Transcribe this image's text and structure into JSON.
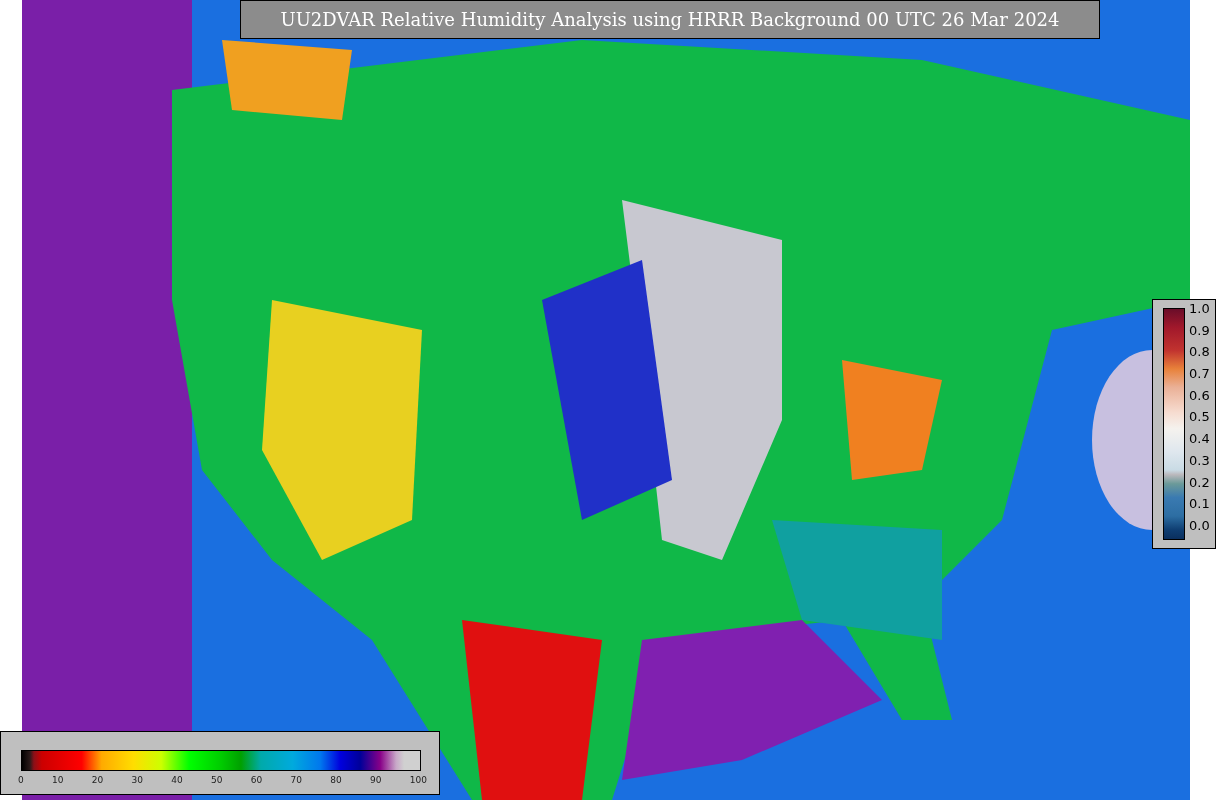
{
  "title": "UU2DVAR Relative Humidity Analysis using HRRR Background 00 UTC 26 Mar 2024",
  "observation_colorbar": {
    "ticks": [
      "1.0",
      "0.9",
      "0.8",
      "0.7",
      "0.6",
      "0.5",
      "0.4",
      "0.3",
      "0.2",
      "0.1",
      "0.0"
    ]
  },
  "analysis_colorbar": {
    "ticks": [
      "0",
      "10",
      "20",
      "30",
      "40",
      "50",
      "60",
      "70",
      "80",
      "90",
      "100"
    ]
  }
}
